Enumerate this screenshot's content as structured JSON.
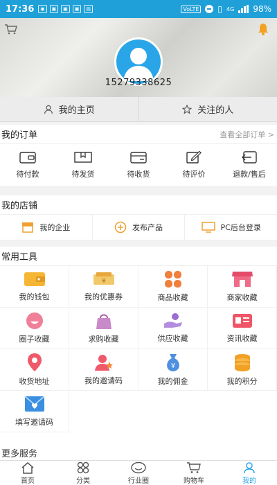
{
  "status_bar": {
    "time": "17:36",
    "network": "VoLTE",
    "signal": "4G",
    "battery": "98%"
  },
  "profile": {
    "phone": "15279338625"
  },
  "nav": {
    "home": "我的主页",
    "follow": "关注的人"
  },
  "orders": {
    "title": "我的订单",
    "view_all": "查看全部订单 >",
    "items": [
      "待付款",
      "待发货",
      "待收货",
      "待评价",
      "退款/售后"
    ]
  },
  "shop": {
    "title": "我的店铺",
    "items": [
      "我的企业",
      "发布产品",
      "PC后台登录"
    ]
  },
  "tools": {
    "title": "常用工具",
    "items": [
      {
        "label": "我的钱包",
        "icon": "wallet-icon"
      },
      {
        "label": "我的优惠券",
        "icon": "coupon-icon"
      },
      {
        "label": "商品收藏",
        "icon": "clover-icon"
      },
      {
        "label": "商家收藏",
        "icon": "store-icon"
      },
      {
        "label": "圈子收藏",
        "icon": "smile-icon"
      },
      {
        "label": "求购收藏",
        "icon": "bag-icon"
      },
      {
        "label": "供应收藏",
        "icon": "hand-icon"
      },
      {
        "label": "资讯收藏",
        "icon": "news-icon"
      },
      {
        "label": "收货地址",
        "icon": "location-icon"
      },
      {
        "label": "我的邀请码",
        "icon": "person-star-icon"
      },
      {
        "label": "我的佣金",
        "icon": "money-bag-icon"
      },
      {
        "label": "我的积分",
        "icon": "coins-icon"
      },
      {
        "label": "填写邀请码",
        "icon": "envelope-heart-icon"
      }
    ]
  },
  "more": {
    "title": "更多服务"
  },
  "tabs": [
    "首页",
    "分类",
    "行业圈",
    "购物车",
    "我的"
  ],
  "colors": {
    "accent": "#2aa6e8",
    "status_bar": "#1fa0d8",
    "orange": "#f0a030"
  }
}
